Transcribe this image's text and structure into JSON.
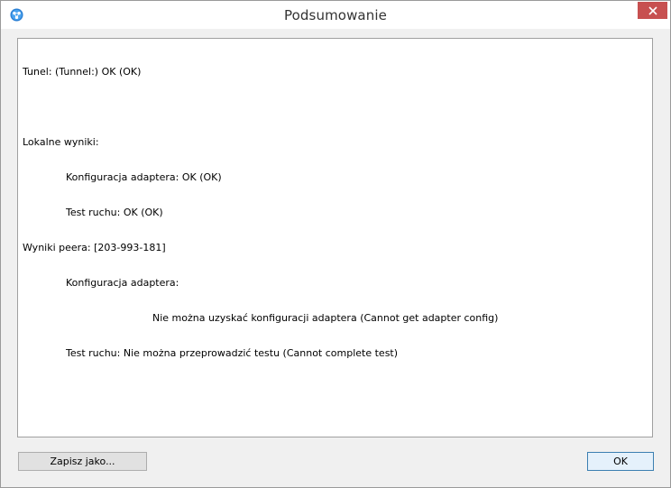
{
  "window": {
    "title": "Podsumowanie",
    "icon": "network-app-icon",
    "close_icon": "close-icon",
    "close_color": "#c75050"
  },
  "summary": {
    "line1": "Tunel: (Tunnel:) OK (OK)",
    "line2": "",
    "line3": "Lokalne wyniki:",
    "line4": "Konfiguracja adaptera: OK (OK)",
    "line5": "Test ruchu: OK (OK)",
    "line6": "Wyniki peera: [203-993-181]",
    "line7": "Konfiguracja adaptera:",
    "line8": "Nie można uzyskać konfiguracji adaptera (Cannot get adapter config)",
    "line9": "Test ruchu: Nie można przeprowadzić testu (Cannot complete test)"
  },
  "buttons": {
    "save_label": "Zapisz jako...",
    "ok_label": "OK"
  }
}
